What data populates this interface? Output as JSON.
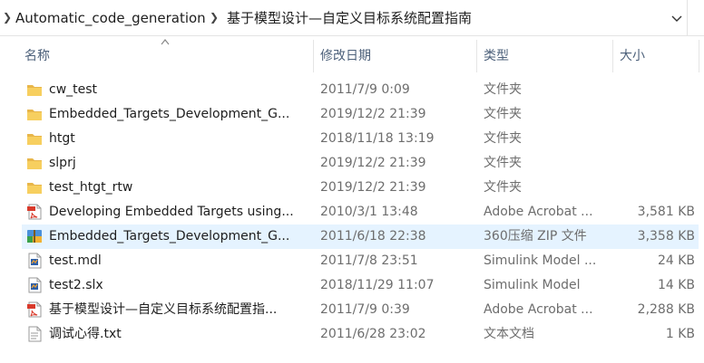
{
  "address": {
    "crumbs": [
      "Automatic_code_generation",
      "基于模型设计—自定义目标系统配置指南"
    ]
  },
  "columns": {
    "name": "名称",
    "date": "修改日期",
    "type": "类型",
    "size": "大小"
  },
  "files": [
    {
      "name": "cw_test",
      "date": "2011/7/9 0:09",
      "type": "文件夹",
      "size": "",
      "icon": "folder-icon"
    },
    {
      "name": "Embedded_Targets_Development_G...",
      "date": "2019/12/2 21:39",
      "type": "文件夹",
      "size": "",
      "icon": "folder-icon"
    },
    {
      "name": "htgt",
      "date": "2018/11/18 13:19",
      "type": "文件夹",
      "size": "",
      "icon": "folder-icon"
    },
    {
      "name": "slprj",
      "date": "2019/12/2 21:39",
      "type": "文件夹",
      "size": "",
      "icon": "folder-icon"
    },
    {
      "name": "test_htgt_rtw",
      "date": "2019/12/2 21:39",
      "type": "文件夹",
      "size": "",
      "icon": "folder-icon"
    },
    {
      "name": "Developing Embedded Targets using...",
      "date": "2010/3/1 13:48",
      "type": "Adobe Acrobat ...",
      "size": "3,581 KB",
      "icon": "pdf-icon"
    },
    {
      "name": "Embedded_Targets_Development_G...",
      "date": "2011/6/18 22:38",
      "type": "360压缩 ZIP 文件",
      "size": "3,358 KB",
      "icon": "zip-icon",
      "selected": true
    },
    {
      "name": "test.mdl",
      "date": "2011/7/8 23:51",
      "type": "Simulink Model ...",
      "size": "24 KB",
      "icon": "simulink-icon"
    },
    {
      "name": "test2.slx",
      "date": "2018/11/29 11:07",
      "type": "Simulink Model",
      "size": "14 KB",
      "icon": "simulink-icon"
    },
    {
      "name": "基于模型设计—自定义目标系统配置指...",
      "date": "2011/7/9 0:39",
      "type": "Adobe Acrobat ...",
      "size": "2,288 KB",
      "icon": "pdf-icon"
    },
    {
      "name": "调试心得.txt",
      "date": "2011/6/28 23:02",
      "type": "文本文档",
      "size": "1 KB",
      "icon": "text-file-icon"
    }
  ]
}
